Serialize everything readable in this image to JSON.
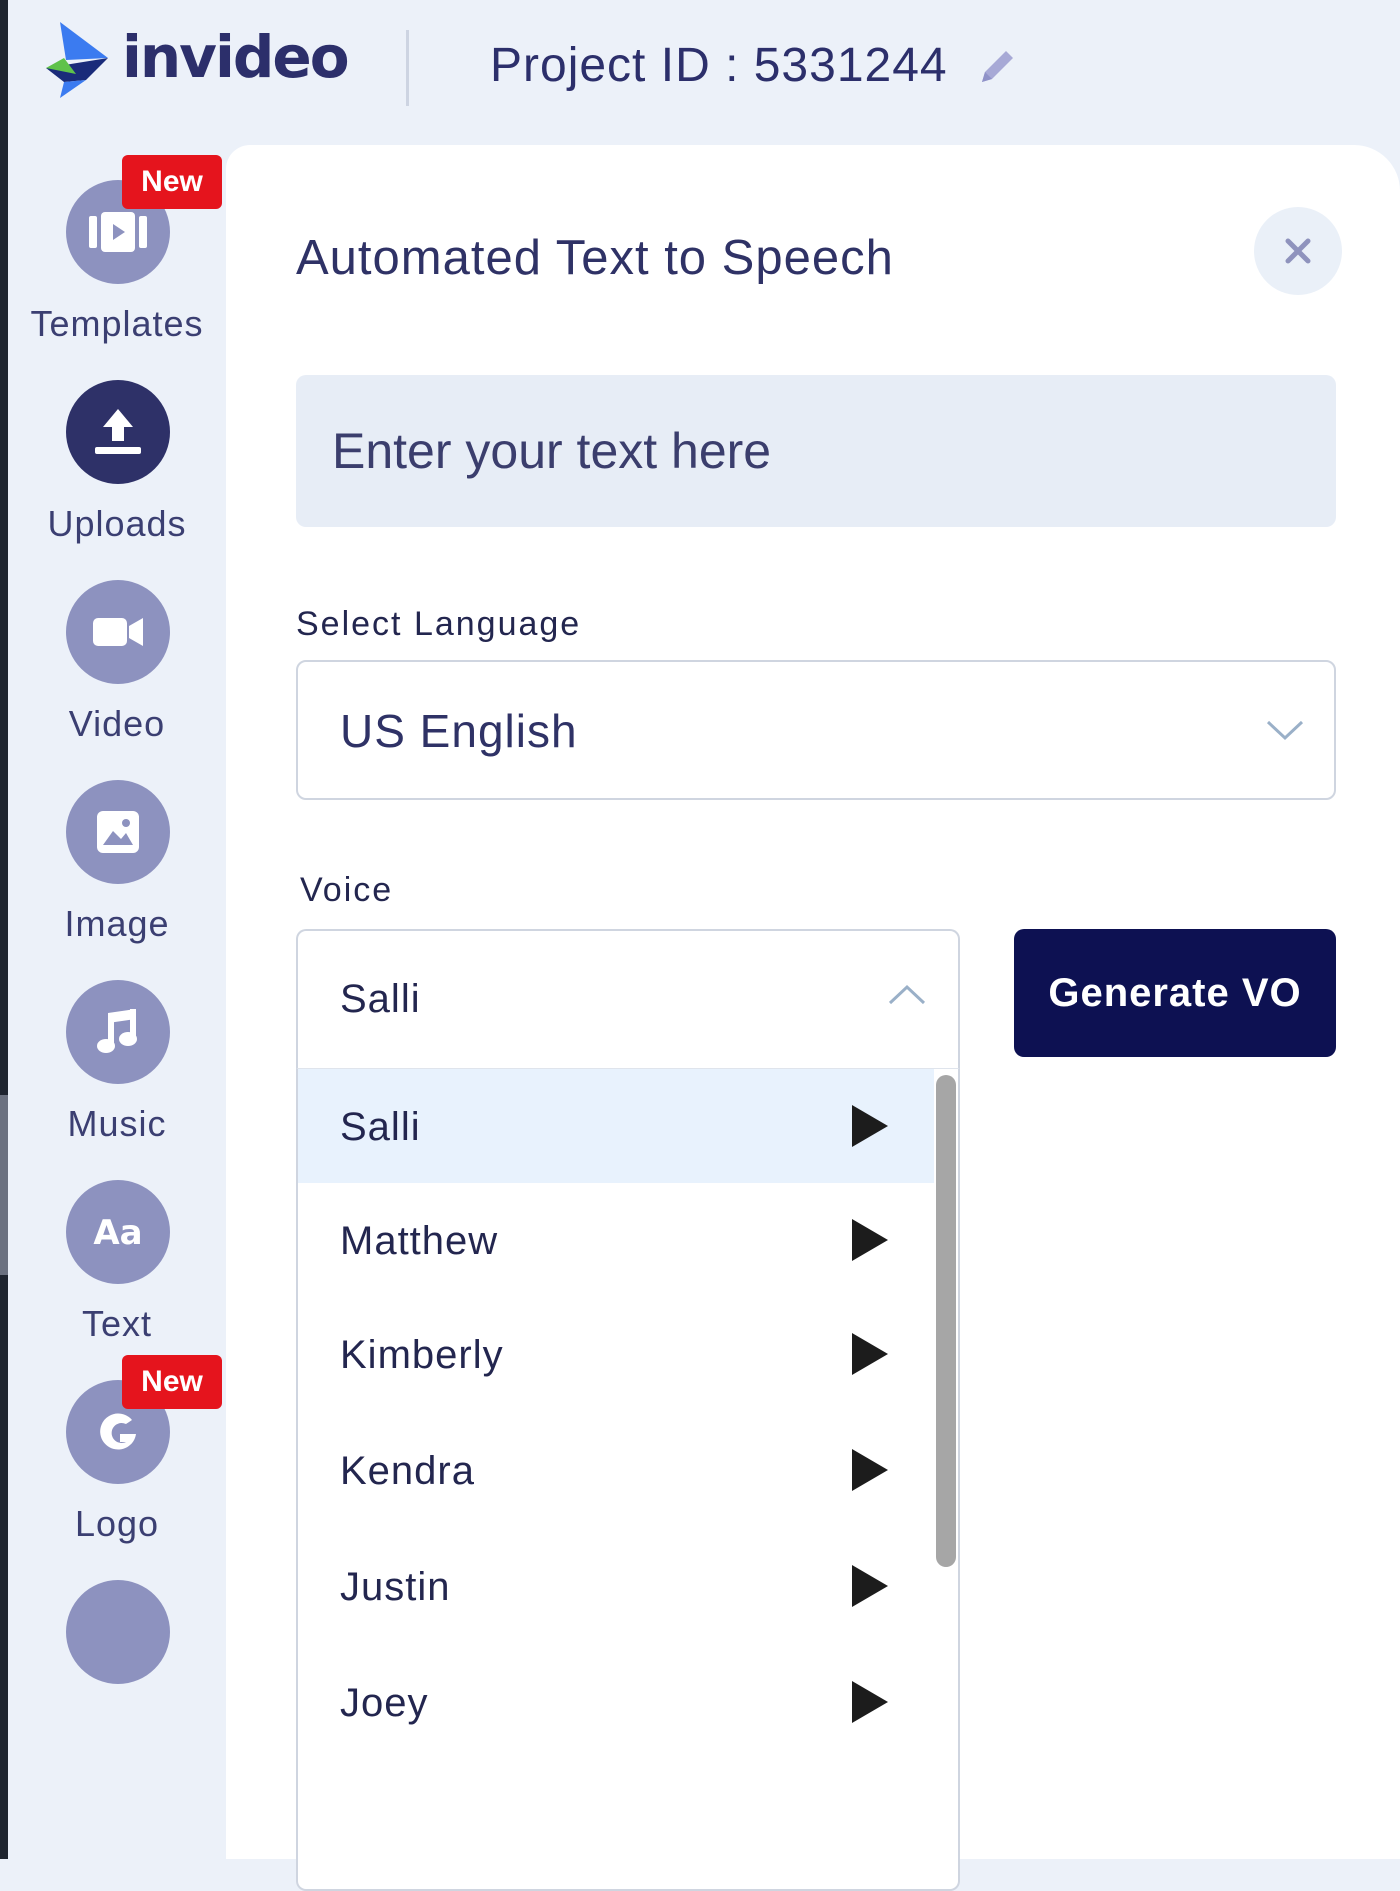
{
  "app": {
    "brand": "invideo",
    "project_id_text": "Project ID : 5331244"
  },
  "sidebar": {
    "items": [
      {
        "label": "Templates",
        "icon": "template-icon",
        "badge": "New",
        "active": false
      },
      {
        "label": "Uploads",
        "icon": "upload-icon",
        "active": true
      },
      {
        "label": "Video",
        "icon": "video-camera-icon",
        "active": false
      },
      {
        "label": "Image",
        "icon": "image-icon",
        "active": false
      },
      {
        "label": "Music",
        "icon": "music-note-icon",
        "active": false
      },
      {
        "label": "Text",
        "icon": "text-aa-icon",
        "active": false
      },
      {
        "label": "Logo",
        "icon": "logo-icon",
        "badge": "New",
        "active": false
      }
    ]
  },
  "panel": {
    "title": "Automated Text to Speech",
    "text_input": {
      "placeholder": "Enter your text here",
      "value": ""
    },
    "language": {
      "label": "Select Language",
      "selected": "US English"
    },
    "voice": {
      "label": "Voice",
      "selected": "Salli",
      "options": [
        "Salli",
        "Matthew",
        "Kimberly",
        "Kendra",
        "Justin",
        "Joey"
      ]
    },
    "generate_button": "Generate VO"
  },
  "colors": {
    "brand_navy": "#0d1152",
    "nav_icon": "#8d92bf",
    "nav_icon_active": "#2e3168",
    "badge_red": "#e5141d",
    "selected_option_bg": "#e8f2fd"
  }
}
